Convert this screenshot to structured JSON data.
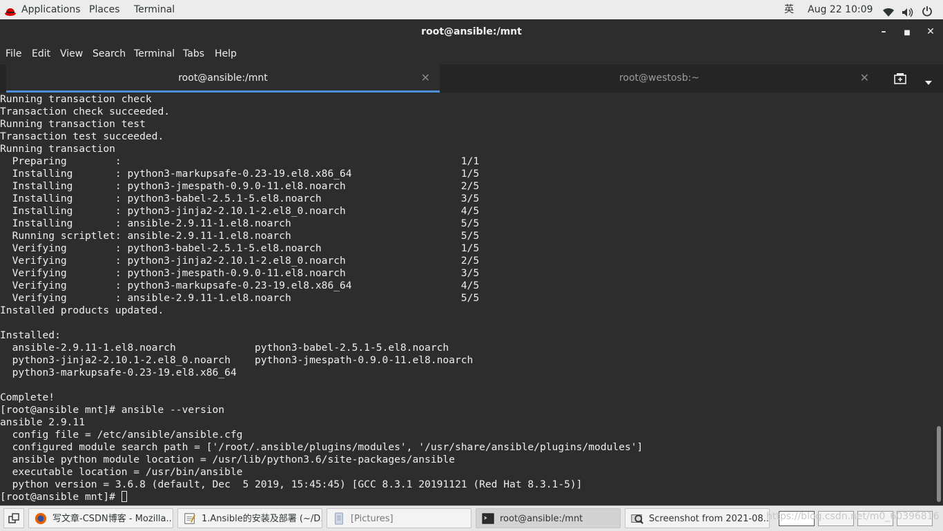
{
  "topbar": {
    "applications": "Applications",
    "places": "Places",
    "terminal": "Terminal",
    "input_method": "英",
    "clock": "Aug 22  10:09"
  },
  "window": {
    "title": "root@ansible:/mnt"
  },
  "menu": [
    "File",
    "Edit",
    "View",
    "Search",
    "Terminal",
    "Tabs",
    "Help"
  ],
  "tabs": [
    {
      "label": "root@ansible:/mnt",
      "active": true
    },
    {
      "label": "root@westosb:~",
      "active": false
    }
  ],
  "terminal": {
    "lines": [
      "Running transaction check",
      "Transaction check succeeded.",
      "Running transaction test",
      "Transaction test succeeded.",
      "Running transaction",
      "  Preparing        :                                                        1/1",
      "  Installing       : python3-markupsafe-0.23-19.el8.x86_64                  1/5",
      "  Installing       : python3-jmespath-0.9.0-11.el8.noarch                   2/5",
      "  Installing       : python3-babel-2.5.1-5.el8.noarch                       3/5",
      "  Installing       : python3-jinja2-2.10.1-2.el8_0.noarch                   4/5",
      "  Installing       : ansible-2.9.11-1.el8.noarch                            5/5",
      "  Running scriptlet: ansible-2.9.11-1.el8.noarch                            5/5",
      "  Verifying        : python3-babel-2.5.1-5.el8.noarch                       1/5",
      "  Verifying        : python3-jinja2-2.10.1-2.el8_0.noarch                   2/5",
      "  Verifying        : python3-jmespath-0.9.0-11.el8.noarch                   3/5",
      "  Verifying        : python3-markupsafe-0.23-19.el8.x86_64                  4/5",
      "  Verifying        : ansible-2.9.11-1.el8.noarch                            5/5",
      "Installed products updated.",
      "",
      "Installed:",
      "  ansible-2.9.11-1.el8.noarch             python3-babel-2.5.1-5.el8.noarch",
      "  python3-jinja2-2.10.1-2.el8_0.noarch    python3-jmespath-0.9.0-11.el8.noarch",
      "  python3-markupsafe-0.23-19.el8.x86_64",
      "",
      "Complete!",
      "[root@ansible mnt]# ansible --version",
      "ansible 2.9.11",
      "  config file = /etc/ansible/ansible.cfg",
      "  configured module search path = ['/root/.ansible/plugins/modules', '/usr/share/ansible/plugins/modules']",
      "  ansible python module location = /usr/lib/python3.6/site-packages/ansible",
      "  executable location = /usr/bin/ansible",
      "  python version = 3.6.8 (default, Dec  5 2019, 15:45:45) [GCC 8.3.1 20191121 (Red Hat 8.3.1-5)]"
    ],
    "prompt": "[root@ansible mnt]# "
  },
  "taskbar": {
    "items": [
      {
        "label": "写文章-CSDN博客 - Mozilla...",
        "icon": "firefox-icon"
      },
      {
        "label": "1.Ansible的安装及部署 (~/D...",
        "icon": "text-editor-icon"
      },
      {
        "label": "[Pictures]",
        "icon": "file-manager-icon"
      },
      {
        "label": "root@ansible:/mnt",
        "icon": "terminal-icon"
      },
      {
        "label": "Screenshot from 2021-08...",
        "icon": "image-viewer-icon"
      }
    ]
  },
  "watermark": "https://blog.csdn.net/m0_60396816",
  "colors": {
    "terminal_bg": "#2d2d2d",
    "terminal_fg": "#eeeeec",
    "accent": "#4a90d9",
    "topbar_bg": "#ececec",
    "redhat": "#d70000"
  }
}
